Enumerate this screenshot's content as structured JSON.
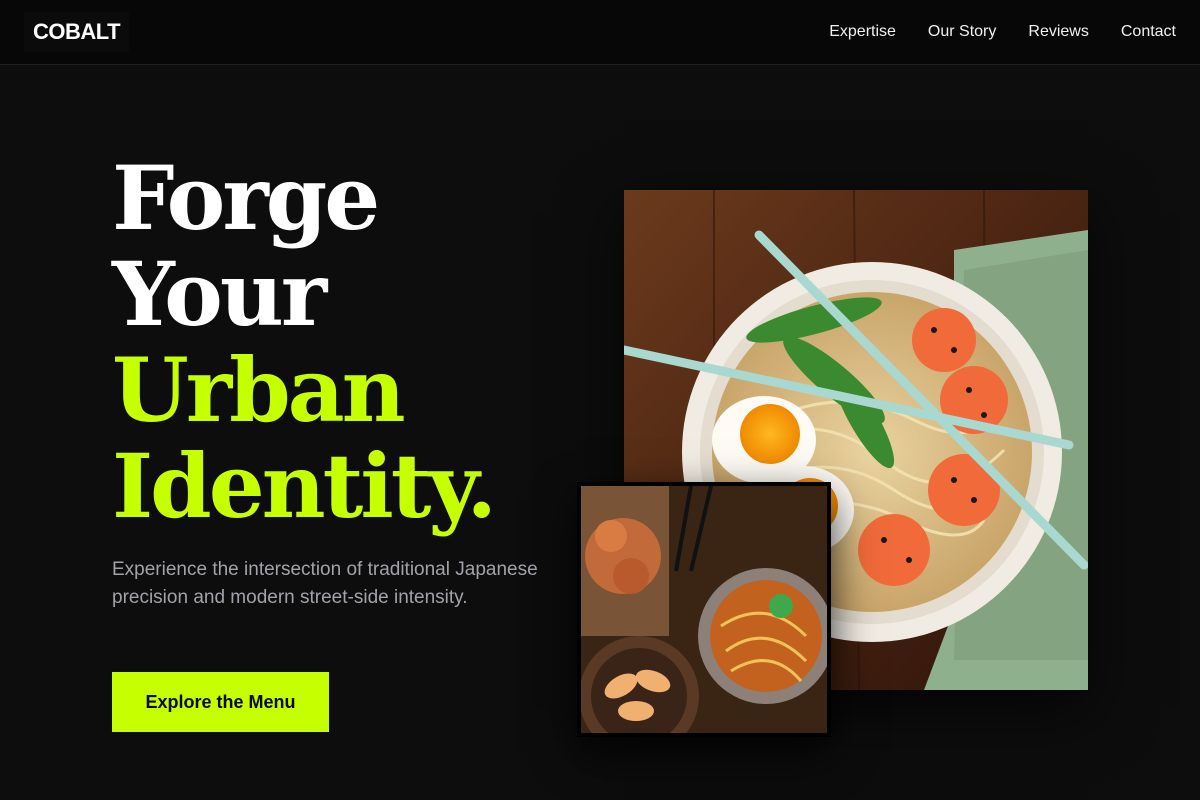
{
  "header": {
    "logo": "COBALT",
    "nav": [
      "Expertise",
      "Our Story",
      "Reviews",
      "Contact"
    ]
  },
  "hero": {
    "headline_line1": "Forge",
    "headline_line2": "Your",
    "headline_line3": "Urban",
    "headline_line4": "Identity.",
    "description": "Experience the intersection of traditional Japanese precision and modern street-side intensity.",
    "cta_label": "Explore the Menu"
  },
  "colors": {
    "background": "#0d0d0d",
    "accent": "#c6ff00",
    "text_muted": "#a2a2aa"
  }
}
